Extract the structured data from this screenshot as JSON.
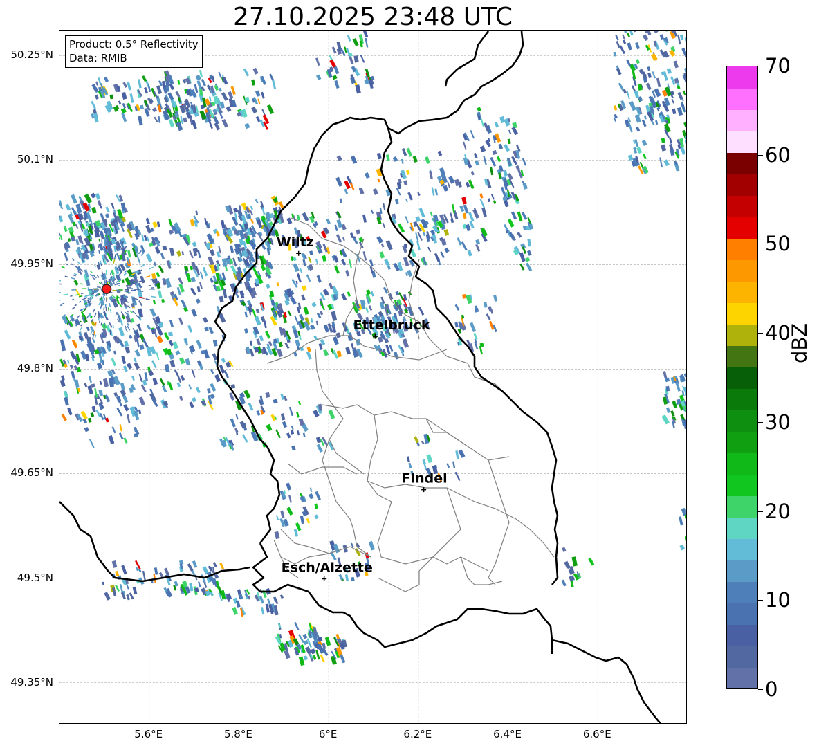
{
  "title": "27.10.2025 23:48 UTC",
  "info_box": {
    "product": "Product: 0.5° Reflectivity",
    "data": "Data: RMIB"
  },
  "map_extent": {
    "lon_min": 5.4,
    "lon_max": 6.8,
    "lat_min": 49.29,
    "lat_max": 50.285
  },
  "lat_ticks": [
    {
      "value": 50.25,
      "label": "50.25°N"
    },
    {
      "value": 50.1,
      "label": "50.1°N"
    },
    {
      "value": 49.95,
      "label": "49.95°N"
    },
    {
      "value": 49.8,
      "label": "49.8°N"
    },
    {
      "value": 49.65,
      "label": "49.65°N"
    },
    {
      "value": 49.5,
      "label": "49.5°N"
    },
    {
      "value": 49.35,
      "label": "49.35°N"
    }
  ],
  "lon_ticks": [
    {
      "value": 5.6,
      "label": "5.6°E"
    },
    {
      "value": 5.8,
      "label": "5.8°E"
    },
    {
      "value": 6.0,
      "label": "6°E"
    },
    {
      "value": 6.2,
      "label": "6.2°E"
    },
    {
      "value": 6.4,
      "label": "6.4°E"
    },
    {
      "value": 6.6,
      "label": "6.6°E"
    }
  ],
  "cities": [
    {
      "name": "Wiltz",
      "lon": 5.933,
      "lat": 49.966
    },
    {
      "name": "Ettelbruck",
      "lon": 6.104,
      "lat": 49.847
    },
    {
      "name": "Findel",
      "lon": 6.212,
      "lat": 49.627
    },
    {
      "name": "Esch/Alzette",
      "lon": 5.99,
      "lat": 49.499
    }
  ],
  "radar_site": {
    "lon": 5.505,
    "lat": 49.915,
    "color": "#ff1a1a"
  },
  "colorbar": {
    "unit": "dBZ",
    "vmin": 0,
    "vmax": 70,
    "ticks": [
      {
        "value": 0,
        "label": "0"
      },
      {
        "value": 10,
        "label": "10"
      },
      {
        "value": 20,
        "label": "20"
      },
      {
        "value": 30,
        "label": "30"
      },
      {
        "value": 40,
        "label": "40"
      },
      {
        "value": 50,
        "label": "50"
      },
      {
        "value": 60,
        "label": "60"
      },
      {
        "value": 70,
        "label": "70"
      }
    ],
    "colors": [
      "#6272a8",
      "#5268a0",
      "#4960a2",
      "#4a72b0",
      "#4e7fb8",
      "#5a9cc7",
      "#62bcd8",
      "#5fd6c4",
      "#3ed46a",
      "#12c620",
      "#10b918",
      "#109f10",
      "#0f8f0f",
      "#0a7a0a",
      "#075f08",
      "#437512",
      "#aeb20a",
      "#fed400",
      "#fdb400",
      "#fe9800",
      "#ff7f00",
      "#e50000",
      "#c40000",
      "#a20000",
      "#7a0000",
      "#ffdfff",
      "#ffb0ff",
      "#ff70ff",
      "#ed3aed"
    ]
  },
  "colors": {
    "country_border": "#000000",
    "canton_border": "#808080",
    "grid": "#b3b3b3"
  }
}
